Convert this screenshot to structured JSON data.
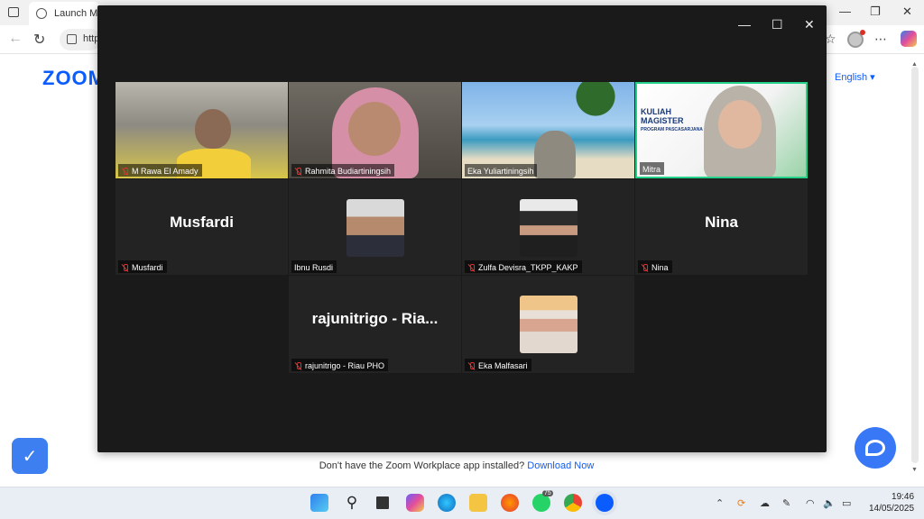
{
  "browser": {
    "tab_title": "Launch Me",
    "address_text": "http",
    "controls": {
      "minimize": "—",
      "restore": "❐",
      "close": "✕"
    }
  },
  "page": {
    "logo": "ZOOM",
    "language": "English ▾",
    "prompt_text": "Don't have the Zoom Workplace app installed?",
    "download_link": "Download Now"
  },
  "zoom_window": {
    "controls": {
      "minimize": "—",
      "maximize": "☐",
      "close": "✕"
    },
    "participants": [
      {
        "name": "M Rawa El Amady",
        "muted": true,
        "type": "video"
      },
      {
        "name": "Rahmita Budiartiningsih",
        "muted": true,
        "type": "video"
      },
      {
        "name": "Eka Yuliartiningsih",
        "muted": false,
        "type": "video"
      },
      {
        "name": "Mitra",
        "muted": false,
        "type": "video",
        "active_speaker": true,
        "banner": [
          "KULIAH",
          "MAGISTER",
          "PROGRAM PASCASARJANA"
        ]
      },
      {
        "name": "Musfardi",
        "display": "Musfardi",
        "muted": true,
        "type": "name"
      },
      {
        "name": "Ibnu Rusdi",
        "muted": false,
        "type": "photo"
      },
      {
        "name": "Zulfa Devisra_TKPP_KAKP",
        "muted": true,
        "type": "photo"
      },
      {
        "name": "Nina",
        "display": "Nina",
        "muted": true,
        "type": "name"
      },
      {
        "name": "rajunitrigo - Riau PHO",
        "display": "rajunitrigo - Ria...",
        "muted": true,
        "type": "name"
      },
      {
        "name": "Eka Malfasari",
        "muted": true,
        "type": "photo"
      }
    ]
  },
  "taskbar": {
    "whatsapp_badge": "75",
    "chrome_badge": "",
    "time": "19:46",
    "date": "14/05/2025"
  },
  "colors": {
    "zoom_blue": "#0b5cff",
    "active_speaker": "#23d18b",
    "muted_red": "#e03131"
  }
}
